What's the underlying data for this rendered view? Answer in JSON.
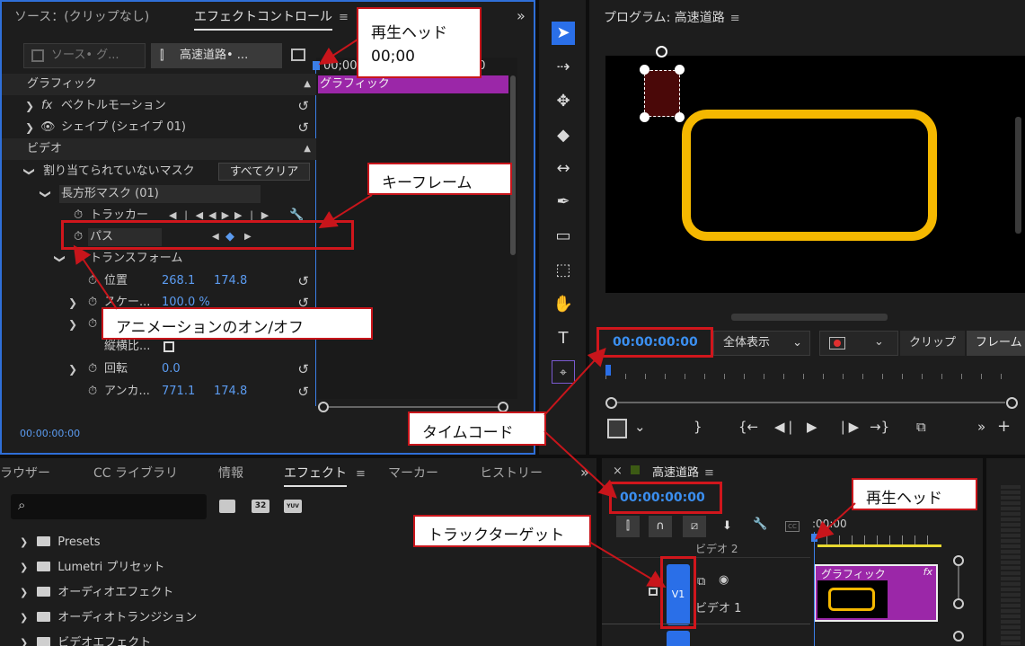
{
  "source_panel": {
    "tab_source": "ソース：(クリップなし)",
    "tab_effects": "エフェクトコントロール",
    "menu_icon": "≡",
    "more_icon": "»",
    "source_dropdown": "ソース• グ...",
    "clip_dropdown": "高速道路• ...",
    "ruler_time": "00;00",
    "ruler_time2": "00",
    "clip_label": "グラフィック",
    "section_graphics": "グラフィック",
    "fx_label": "fx",
    "vector_motion": "ベクトルモーション",
    "shape": "シェイプ (シェイプ 01)",
    "section_video": "ビデオ",
    "unassigned_mask": "割り当てられていないマスク",
    "clear_all": "すべてクリア",
    "rect_mask": "長方形マスク (01)",
    "tracker": "トラッカー",
    "path": "パス",
    "transform": "トランスフォーム",
    "position": "位置",
    "position_x": "268.1",
    "position_y": "174.8",
    "scale": "スケー...",
    "scale_value": "100.0 %",
    "aspect": "縦横比...",
    "rotation": "回転",
    "rotation_value": "0.0",
    "anchor": "アンカ...",
    "anchor_x": "771.1",
    "anchor_y": "174.8",
    "timecode": "00:00:00:00"
  },
  "program_panel": {
    "title": "プログラム: 高速道路",
    "menu_icon": "≡",
    "timecode": "00:00:00:00",
    "zoom": "全体表示",
    "clip_btn": "クリップ",
    "frame_btn": "フレーム",
    "shape_color": "#f5b800",
    "mask_color": "#4a0808"
  },
  "bottom_panel": {
    "tabs": [
      "ラウザー",
      "CC ライブラリ",
      "情報",
      "エフェクト",
      "マーカー",
      "ヒストリー"
    ],
    "active_tab": "エフェクト",
    "menu_icon": "≡",
    "badge_32": "32",
    "badge_yuv": "YUV",
    "items": [
      "Presets",
      "Lumetri プリセット",
      "オーディオエフェクト",
      "オーディオトランジション",
      "ビデオエフェクト"
    ]
  },
  "timeline_panel": {
    "close": "×",
    "title": "高速道路",
    "menu_icon": "≡",
    "timecode": "00:00:00:00",
    "ruler_time": ":00:00",
    "video2": "ビデオ 2",
    "video1": "ビデオ 1",
    "v1": "V1",
    "clip_label": "グラフィック",
    "fx_label": "fx",
    "clip_color": "#9b27a8"
  },
  "annotations": {
    "playhead_top_line1": "再生ヘッド",
    "playhead_top_line2": "00;00",
    "keyframe": "キーフレーム",
    "anim_toggle": "アニメーションのオン/オフ",
    "timecode": "タイムコード",
    "playhead_bottom": "再生ヘッド",
    "track_target": "トラックターゲット",
    "accent": "#c8151b"
  },
  "colors": {
    "accent_blue": "#2a6fe8",
    "timecode_blue": "#3b8ff0",
    "bg": "#1d1d1d"
  }
}
